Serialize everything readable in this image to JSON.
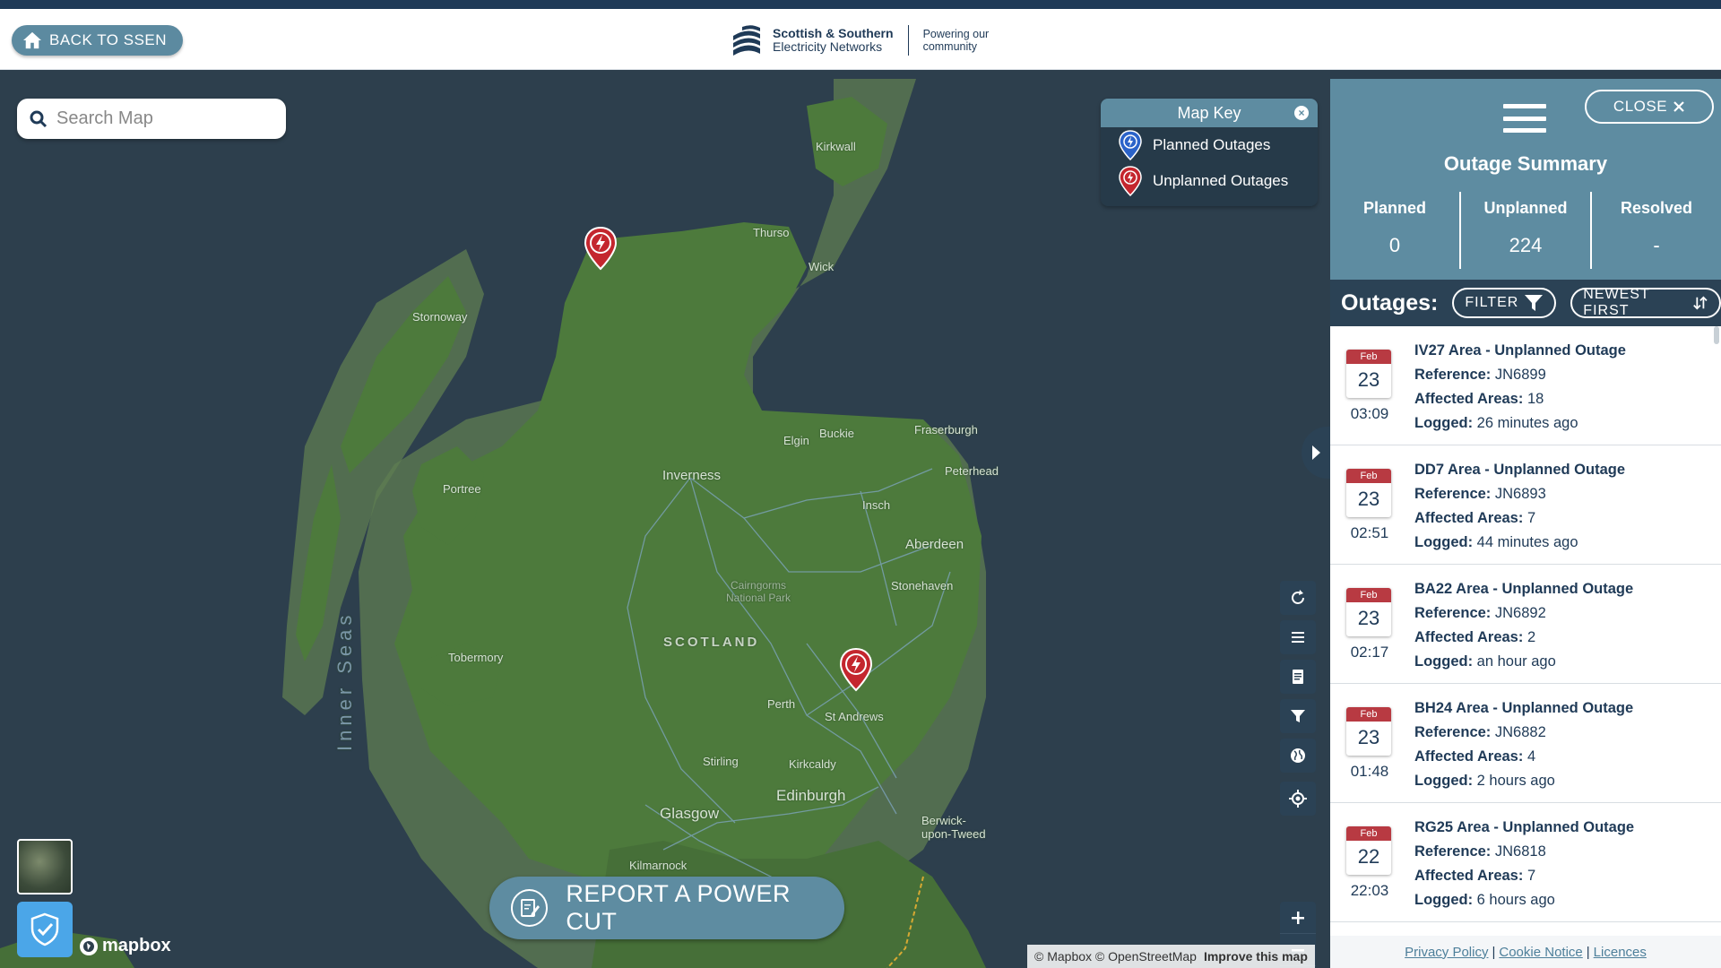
{
  "header": {
    "back_label": "BACK TO SSEN",
    "logo_line1": "Scottish & Southern",
    "logo_line2": "Electricity Networks",
    "tagline_line1": "Powering our",
    "tagline_line2": "community",
    "brand_color": "#1f3a57"
  },
  "map": {
    "search_placeholder": "Search Map",
    "places": {
      "kirkwall": "Kirkwall",
      "thurso": "Thurso",
      "wick": "Wick",
      "stornoway": "Stornoway",
      "elgin": "Elgin",
      "buckie": "Buckie",
      "fraserburgh": "Fraserburgh",
      "peterhead": "Peterhead",
      "inverness": "Inverness",
      "portree": "Portree",
      "insch": "Insch",
      "aberdeen": "Aberdeen",
      "cairngorms_1": "Cairngorms",
      "cairngorms_2": "National Park",
      "stonehaven": "Stonehaven",
      "scotland": "SCOTLAND",
      "tobermory": "Tobermory",
      "inner_seas": "Inner Seas",
      "perth": "Perth",
      "st_andrews": "St Andrews",
      "stirling": "Stirling",
      "kirkcaldy": "Kirkcaldy",
      "edinburgh": "Edinburgh",
      "glasgow": "Glasgow",
      "berwick_1": "Berwick-",
      "berwick_2": "upon-Tweed",
      "kilmarnock": "Kilmarnock"
    },
    "key": {
      "title": "Map Key",
      "planned": "Planned Outages",
      "unplanned": "Unplanned Outages",
      "planned_color": "#2b63c9",
      "unplanned_color": "#c4262e"
    },
    "report_label": "REPORT A POWER CUT",
    "mapbox_label": "mapbox",
    "attribution": "© Mapbox © OpenStreetMap",
    "improve_label": "Improve this map",
    "controls": [
      "refresh-icon",
      "list-icon",
      "document-icon",
      "filter-icon",
      "globe-icon",
      "locate-icon",
      "zoom-in-icon",
      "zoom-out-icon",
      "compass-icon"
    ]
  },
  "panel": {
    "close_label": "CLOSE",
    "summary_title": "Outage Summary",
    "stats": [
      {
        "label": "Planned",
        "value": "0"
      },
      {
        "label": "Unplanned",
        "value": "224"
      },
      {
        "label": "Resolved",
        "value": "-"
      }
    ],
    "outages_title": "Outages:",
    "filter_label": "FILTER",
    "sort_label": "NEWEST FIRST",
    "ref_label": "Reference:",
    "areas_label": "Affected Areas:",
    "logged_label": "Logged:",
    "items": [
      {
        "month": "Feb",
        "day": "23",
        "time": "03:09",
        "title": "IV27 Area - Unplanned Outage",
        "reference": "JN6899",
        "areas": "18",
        "logged": "26 minutes ago"
      },
      {
        "month": "Feb",
        "day": "23",
        "time": "02:51",
        "title": "DD7 Area - Unplanned Outage",
        "reference": "JN6893",
        "areas": "7",
        "logged": "44 minutes ago"
      },
      {
        "month": "Feb",
        "day": "23",
        "time": "02:17",
        "title": "BA22 Area - Unplanned Outage",
        "reference": "JN6892",
        "areas": "2",
        "logged": "an hour ago"
      },
      {
        "month": "Feb",
        "day": "23",
        "time": "01:48",
        "title": "BH24 Area - Unplanned Outage",
        "reference": "JN6882",
        "areas": "4",
        "logged": "2 hours ago"
      },
      {
        "month": "Feb",
        "day": "22",
        "time": "22:03",
        "title": "RG25 Area - Unplanned Outage",
        "reference": "JN6818",
        "areas": "7",
        "logged": "6 hours ago"
      }
    ],
    "footer": {
      "privacy": "Privacy Policy",
      "cookie": "Cookie Notice",
      "licences": "Licences",
      "separator": "|"
    }
  }
}
